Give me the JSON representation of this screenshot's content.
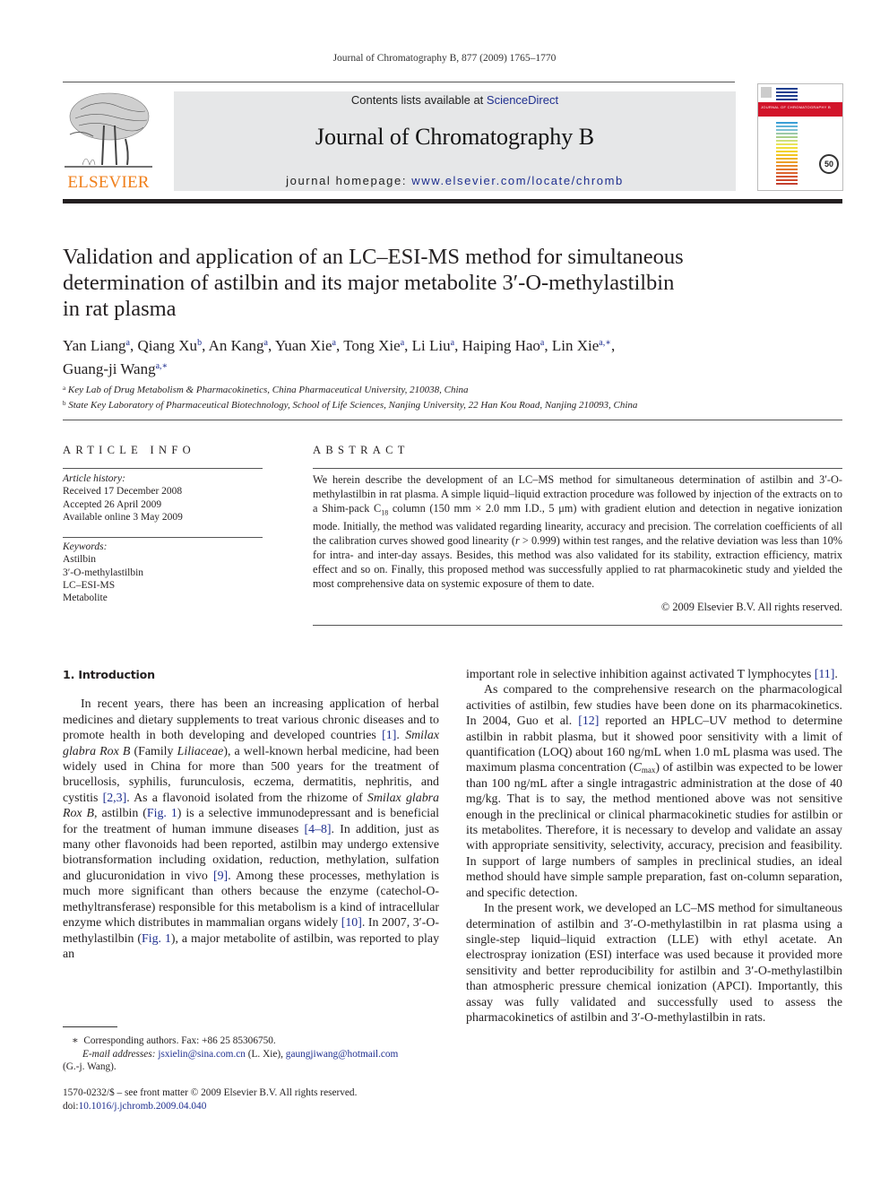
{
  "running_head": "Journal of Chromatography B, 877 (2009) 1765–1770",
  "masthead": {
    "publisher_wordmark": "ELSEVIER",
    "contents_prefix": "Contents lists available at ",
    "contents_link": "ScienceDirect",
    "journal_title": "Journal of Chromatography B",
    "homepage_prefix": "journal homepage: ",
    "homepage_link": "www.elsevier.com/locate/chromb",
    "cover_banner_text": "JOURNAL OF CHROMATOGRAPHY B",
    "cover_badge": "50",
    "colors": {
      "wordmark": "#f07f1b",
      "banner_bg": "#e6e7e8",
      "link": "#1f2f8f",
      "cover_red": "#d2142a"
    }
  },
  "article": {
    "title_lines": [
      "Validation and application of an LC–ESI-MS method for simultaneous",
      "determination of astilbin and its major metabolite 3′-O-methylastilbin",
      "in rat plasma"
    ],
    "authors": [
      {
        "name": "Yan Liang",
        "aff": "a",
        "sep": ", "
      },
      {
        "name": "Qiang Xu",
        "aff": "b",
        "sep": ", "
      },
      {
        "name": "An Kang",
        "aff": "a",
        "sep": ", "
      },
      {
        "name": "Yuan Xie",
        "aff": "a",
        "sep": ", "
      },
      {
        "name": "Tong Xie",
        "aff": "a",
        "sep": ", "
      },
      {
        "name": "Li Liu",
        "aff": "a",
        "sep": ", "
      },
      {
        "name": "Haiping Hao",
        "aff": "a",
        "sep": ", "
      },
      {
        "name": "Lin Xie",
        "aff": "a,∗",
        "sep": ","
      },
      {
        "name": "Guang-ji Wang",
        "aff": "a,∗",
        "sep": ""
      }
    ],
    "affiliations": [
      {
        "mark": "a",
        "text": "Key Lab of Drug Metabolism & Pharmacokinetics, China Pharmaceutical University, 210038, China"
      },
      {
        "mark": "b",
        "text": "State Key Laboratory of Pharmaceutical Biotechnology, School of Life Sciences, Nanjing University, 22 Han Kou Road, Nanjing 210093, China"
      }
    ]
  },
  "article_info": {
    "heading": "ARTICLE INFO",
    "history_label": "Article history:",
    "history": [
      "Received 17 December 2008",
      "Accepted 26 April 2009",
      "Available online 3 May 2009"
    ],
    "keywords_label": "Keywords:",
    "keywords": [
      "Astilbin",
      "3′-O-methylastilbin",
      "LC–ESI-MS",
      "Metabolite"
    ]
  },
  "abstract": {
    "heading": "ABSTRACT",
    "p1": "We herein describe the development of an LC–MS method for simultaneous determination of astilbin and 3′-O-methylastilbin in rat plasma. A simple liquid–liquid extraction procedure was followed by injection of the extracts on to a Shim-pack C",
    "sub1": "18",
    "p2": " column (150 mm × 2.0 mm I.D., 5 μm) with gradient elution and detection in negative ionization mode. Initially, the method was validated regarding linearity, accuracy and precision. The correlation coefficients of all the calibration curves showed good linearity (",
    "r_var": "r",
    "p3": " > 0.999) within test ranges, and the relative deviation was less than 10% for intra- and inter-day assays. Besides, this method was also validated for its stability, extraction efficiency, matrix effect and so on. Finally, this proposed method was successfully applied to rat pharmacokinetic study and yielded the most comprehensive data on systemic exposure of them to date.",
    "copyright": "© 2009 Elsevier B.V. All rights reserved."
  },
  "body": {
    "section_heading": "1.  Introduction",
    "para1": {
      "s1": "In recent years, there has been an increasing application of herbal medicines and dietary supplements to treat various chronic diseases and to promote health in both developing and developed countries ",
      "ref1": "[1]",
      "s2": ". ",
      "it1": "Smilax glabra Rox B",
      "s3": " (Family ",
      "it2": "Liliaceae",
      "s4": "), a well-known herbal medicine, had been widely used in China for more than 500 years for the treatment of brucellosis, syphilis, furunculosis, eczema, dermatitis, nephritis, and cystitis ",
      "ref2": "[2,3]",
      "s5": ". As a flavonoid isolated from the rhizome of ",
      "it3": "Smilax glabra Rox B",
      "s6": ", astilbin (",
      "ref3": "Fig. 1",
      "s7": ") is a selective immunodepressant and is beneficial for the treatment of human immune diseases ",
      "ref4": "[4–8]",
      "s8": ". In addition, just as many other flavonoids had been reported, astilbin may undergo extensive biotransformation including oxidation, reduction, methylation, sulfation and glucuronidation in vivo ",
      "ref5": "[9]",
      "s9": ". Among these processes, methylation is much more significant than others because the enzyme (catechol-O-methyltransferase) responsible for this metabolism is a kind of intracellular enzyme which distributes in mammalian organs widely ",
      "ref6": "[10]",
      "s10": ". In 2007, 3′-O-methylastilbin (",
      "ref7": "Fig. 1",
      "s11": "), a major metabolite of astilbin, was reported to play an important role in selective inhibition against activated T lymphocytes ",
      "ref8": "[11]",
      "s12": "."
    },
    "para2": {
      "s1": "As compared to the comprehensive research on the pharmacological activities of astilbin, few studies have been done on its pharmacokinetics. In 2004, Guo et al. ",
      "ref1": "[12]",
      "s2": " reported an HPLC–UV method to determine astilbin in rabbit plasma, but it showed poor sensitivity with a limit of quantification (LOQ) about 160 ng/mL when 1.0 mL plasma was used. The maximum plasma concentration (",
      "cmax_c": "C",
      "cmax_sub": "max",
      "s3": ") of astilbin was expected to be lower than 100 ng/mL after a single intragastric administration at the dose of 40 mg/kg. That is to say, the method mentioned above was not sensitive enough in the preclinical or clinical pharmacokinetic studies for astilbin or its metabolites. Therefore, it is necessary to develop and validate an assay with appropriate sensitivity, selectivity, accuracy, precision and feasibility. In support of large numbers of samples in preclinical studies, an ideal method should have simple sample preparation, fast on-column separation, and specific detection."
    },
    "para3": "In the present work, we developed an LC–MS method for simultaneous determination of astilbin and 3′-O-methylastilbin in rat plasma using a single-step liquid–liquid extraction (LLE) with ethyl acetate. An electrospray ionization (ESI) interface was used because it provided more sensitivity and better reproducibility for astilbin and 3′-O-methylastilbin than atmospheric pressure chemical ionization (APCI). Importantly, this assay was fully validated and successfully used to assess the pharmacokinetics of astilbin and 3′-O-methylastilbin in rats."
  },
  "footnotes": {
    "corresponding_mark": "∗",
    "corresponding_text": "Corresponding authors. Fax: +86 25 85306750.",
    "email_label": "E-mail addresses:",
    "email1": "jsxielin@sina.com.cn",
    "email1_owner": " (L. Xie), ",
    "email2": "gaungjiwang@hotmail.com",
    "email2_owner": "(G.-j. Wang)."
  },
  "front_matter": {
    "issn_line": "1570-0232/$ – see front matter © 2009 Elsevier B.V. All rights reserved.",
    "doi_label": "doi:",
    "doi_link": "10.1016/j.jchromb.2009.04.040"
  }
}
